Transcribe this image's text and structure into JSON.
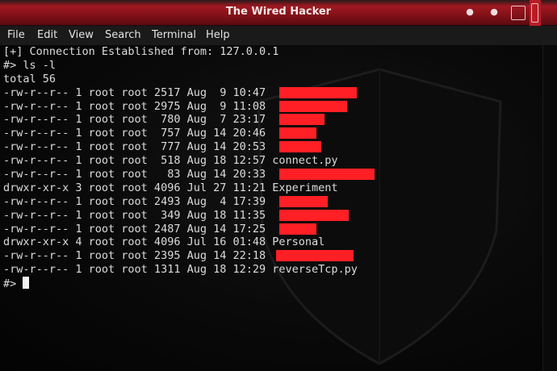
{
  "window": {
    "title": "The Wired Hacker"
  },
  "menu": [
    "File",
    "Edit",
    "View",
    "Search",
    "Terminal",
    "Help"
  ],
  "terminal": {
    "lines": [
      "[+] Connection Established from: 127.0.0.1",
      "#> ls -l",
      "total 56",
      "-rw-r--r-- 1 root root 2517 Aug  9 10:47 ",
      "-rw-r--r-- 1 root root 2975 Aug  9 11:08 ",
      "-rw-r--r-- 1 root root  780 Aug  7 23:17 ",
      "-rw-r--r-- 1 root root  757 Aug 14 20:46 ",
      "-rw-r--r-- 1 root root  777 Aug 14 20:53 ",
      "-rw-r--r-- 1 root root  518 Aug 18 12:57 connect.py",
      "-rw-r--r-- 1 root root   83 Aug 14 20:33 ",
      "drwxr-xr-x 3 root root 4096 Jul 27 11:21 Experiment",
      "-rw-r--r-- 1 root root 2493 Aug  4 17:39 ",
      "-rw-r--r-- 1 root root  349 Aug 18 11:35 ",
      "-rw-r--r-- 1 root root 2487 Aug 14 17:25 ",
      "drwxr-xr-x 4 root root 4096 Jul 16 01:48 Personal",
      "-rw-r--r-- 1 root root 2395 Aug 14 22:18 ",
      "-rw-r--r-- 1 root root 1311 Aug 18 12:29 reverseTcp.py"
    ],
    "prompt": "#> ",
    "colors": {
      "text": "#dcdcdc",
      "redaction": "#ff1f25",
      "titlebar": "#a01820"
    }
  }
}
